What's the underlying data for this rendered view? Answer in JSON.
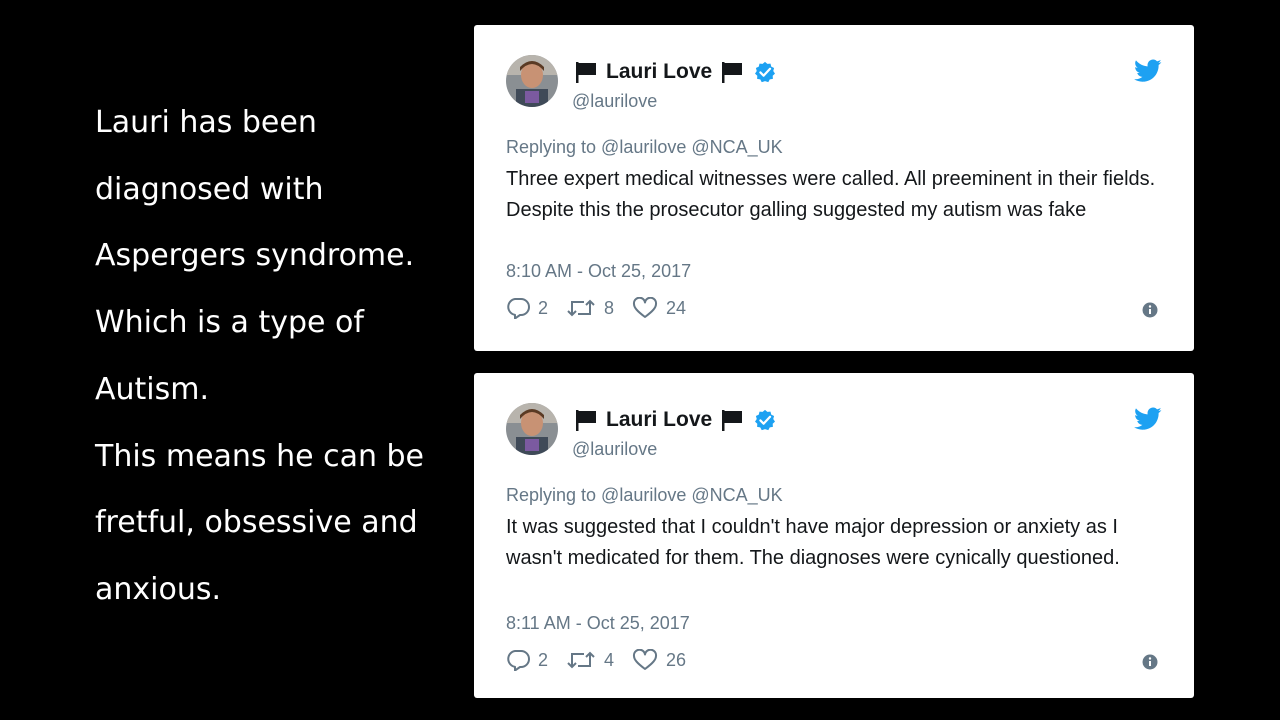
{
  "caption": {
    "lines": [
      "Lauri has been",
      "diagnosed with",
      "Aspergers syndrome.",
      "Which is a type of",
      "Autism.",
      "This means he can be",
      "fretful, obsessive and",
      "anxious."
    ]
  },
  "colors": {
    "background": "#000000",
    "card": "#ffffff",
    "twitter_blue": "#1da1f2",
    "text_primary": "#14171a",
    "text_secondary": "#657786"
  },
  "tweets": [
    {
      "display_name": "Lauri Love",
      "handle": "@laurilove",
      "reply_to": "Replying to @laurilove @NCA_UK",
      "text": "Three expert medical witnesses were called. All preeminent in their fields. Despite this the prosecutor galling suggested my autism was fake",
      "timestamp": "8:10 AM - Oct 25, 2017",
      "replies": "2",
      "retweets": "8",
      "likes": "24",
      "icons": [
        "flag-icon",
        "verified-badge-icon",
        "twitter-bird-icon",
        "reply-icon",
        "retweet-icon",
        "heart-icon",
        "info-icon"
      ]
    },
    {
      "display_name": "Lauri Love",
      "handle": "@laurilove",
      "reply_to": "Replying to @laurilove @NCA_UK",
      "text": "It was suggested that I couldn't have major depression or anxiety as I wasn't medicated for them. The diagnoses were cynically questioned.",
      "timestamp": "8:11 AM - Oct 25, 2017",
      "replies": "2",
      "retweets": "4",
      "likes": "26",
      "icons": [
        "flag-icon",
        "verified-badge-icon",
        "twitter-bird-icon",
        "reply-icon",
        "retweet-icon",
        "heart-icon",
        "info-icon"
      ]
    }
  ]
}
